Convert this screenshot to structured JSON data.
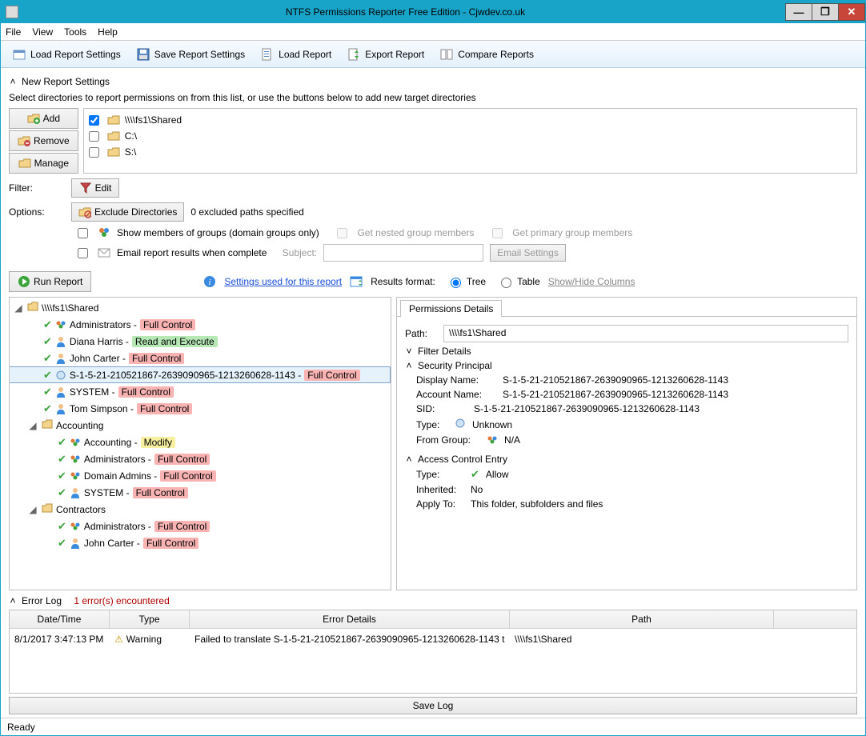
{
  "window": {
    "title": "NTFS Permissions Reporter Free Edition - Cjwdev.co.uk"
  },
  "menu": {
    "file": "File",
    "view": "View",
    "tools": "Tools",
    "help": "Help"
  },
  "toolbar": {
    "load_settings": "Load Report Settings",
    "save_settings": "Save Report Settings",
    "load_report": "Load Report",
    "export_report": "Export Report",
    "compare_reports": "Compare Reports"
  },
  "settings": {
    "header": "New Report Settings",
    "subtext": "Select directories to report permissions on from this list, or use the buttons below to add new target directories",
    "buttons": {
      "add": "Add",
      "remove": "Remove",
      "manage": "Manage"
    },
    "dirs": [
      {
        "checked": true,
        "label": "\\\\\\\\fs1\\Shared"
      },
      {
        "checked": false,
        "label": "C:\\"
      },
      {
        "checked": false,
        "label": "S:\\"
      }
    ],
    "filter_label": "Filter:",
    "edit": "Edit",
    "options_label": "Options:",
    "exclude": "Exclude Directories",
    "exclude_note": "0 excluded paths specified",
    "show_members": "Show members of groups  (domain groups only)",
    "nested": "Get nested group members",
    "primary": "Get primary group members",
    "email_results": "Email report results when complete",
    "subject_label": "Subject:",
    "email_settings": "Email Settings"
  },
  "runbar": {
    "run": "Run Report",
    "settings_link": "Settings used for this report",
    "results_format": "Results format:",
    "tree": "Tree",
    "table": "Table",
    "show_hide": "Show/Hide Columns"
  },
  "tree": {
    "root": "\\\\\\\\fs1\\Shared",
    "nodes": [
      {
        "kind": "group",
        "name": "Administrators",
        "perm": "Full Control",
        "permClass": "full"
      },
      {
        "kind": "user",
        "name": "Diana Harris",
        "perm": "Read and Execute",
        "permClass": "read"
      },
      {
        "kind": "user",
        "name": "John Carter",
        "perm": "Full Control",
        "permClass": "full"
      },
      {
        "kind": "sid",
        "name": "S-1-5-21-210521867-2639090965-1213260628-1143",
        "perm": "Full Control",
        "permClass": "full",
        "selected": true
      },
      {
        "kind": "user",
        "name": "SYSTEM",
        "perm": "Full Control",
        "permClass": "full"
      },
      {
        "kind": "user",
        "name": "Tom Simpson",
        "perm": "Full Control",
        "permClass": "full"
      }
    ],
    "folders": [
      {
        "name": "Accounting",
        "children": [
          {
            "kind": "group",
            "name": "Accounting",
            "perm": "Modify",
            "permClass": "modify"
          },
          {
            "kind": "group",
            "name": "Administrators",
            "perm": "Full Control",
            "permClass": "full"
          },
          {
            "kind": "group",
            "name": "Domain Admins",
            "perm": "Full Control",
            "permClass": "full"
          },
          {
            "kind": "user",
            "name": "SYSTEM",
            "perm": "Full Control",
            "permClass": "full"
          }
        ]
      },
      {
        "name": "Contractors",
        "children": [
          {
            "kind": "group",
            "name": "Administrators",
            "perm": "Full Control",
            "permClass": "full"
          },
          {
            "kind": "user",
            "name": "John Carter",
            "perm": "Full Control",
            "permClass": "full"
          }
        ]
      }
    ]
  },
  "details": {
    "tab": "Permissions Details",
    "path_label": "Path:",
    "path": "\\\\\\\\fs1\\Shared",
    "filter_header": "Filter Details",
    "principal_header": "Security Principal",
    "display_name_label": "Display Name:",
    "display_name": "S-1-5-21-210521867-2639090965-1213260628-1143",
    "account_name_label": "Account Name:",
    "account_name": "S-1-5-21-210521867-2639090965-1213260628-1143",
    "sid_label": "SID:",
    "sid": "S-1-5-21-210521867-2639090965-1213260628-1143",
    "type_label": "Type:",
    "type": "Unknown",
    "from_group_label": "From Group:",
    "from_group": "N/A",
    "ace_header": "Access Control Entry",
    "ace_type_label": "Type:",
    "ace_type": "Allow",
    "inherited_label": "Inherited:",
    "inherited": "No",
    "apply_to_label": "Apply To:",
    "apply_to": "This folder, subfolders and files"
  },
  "errorlog": {
    "header": "Error Log",
    "count": "1 error(s) encountered",
    "columns": {
      "datetime": "Date/Time",
      "type": "Type",
      "details": "Error Details",
      "path": "Path"
    },
    "rows": [
      {
        "datetime": "8/1/2017 3:47:13 PM",
        "type": "Warning",
        "details": "Failed to translate S-1-5-21-210521867-2639090965-1213260628-1143 t",
        "path": "\\\\\\\\fs1\\Shared"
      }
    ],
    "save": "Save Log"
  },
  "status": {
    "ready": "Ready"
  }
}
